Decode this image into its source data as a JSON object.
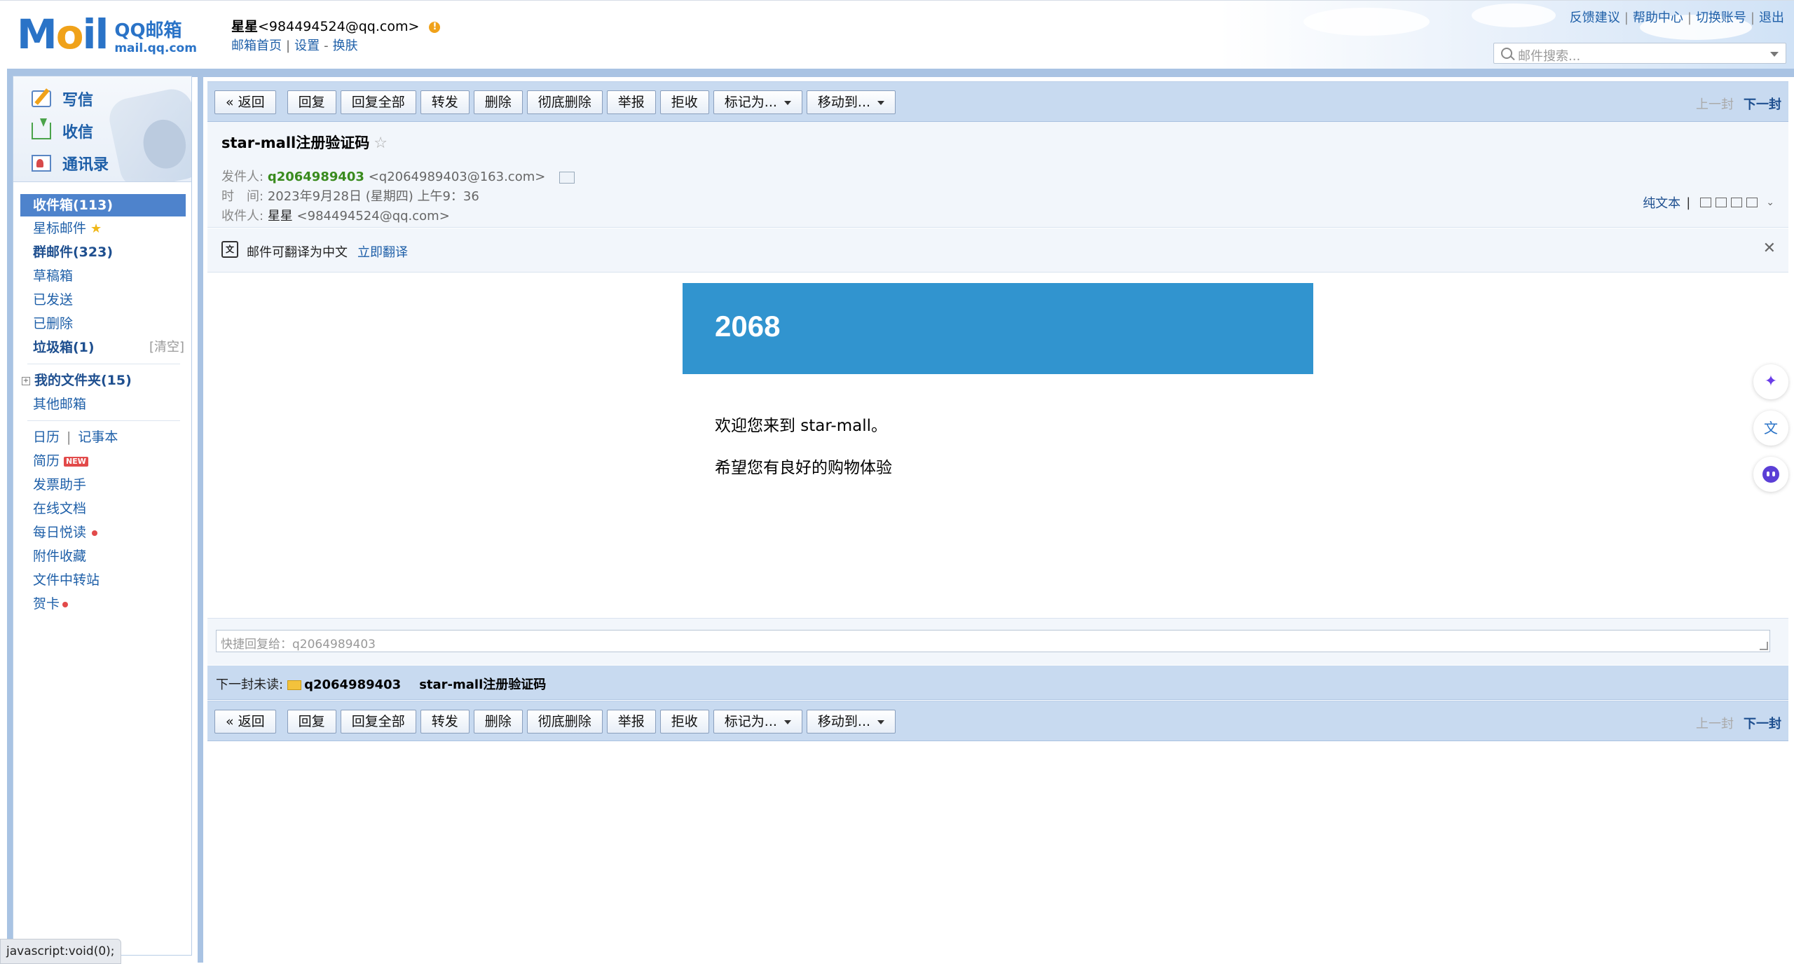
{
  "header": {
    "user_name": "星星",
    "user_email": "<984494524@qq.com>",
    "home_link": "邮箱首页",
    "settings_link": "设置",
    "skin_link": "换肤",
    "dash": "-",
    "logo_mail": "MAIL",
    "logo_qq": "QQ邮箱",
    "logo_domain": "mail.qq.com",
    "top_links": [
      "反馈建议",
      "帮助中心",
      "切换账号",
      "退出"
    ],
    "search_placeholder": "邮件搜索..."
  },
  "sidebar": {
    "quick": [
      "写信",
      "收信",
      "通讯录"
    ],
    "folders": {
      "inbox": "收件箱(113)",
      "starred": "星标邮件",
      "group": "群邮件(323)",
      "drafts": "草稿箱",
      "sent": "已发送",
      "deleted": "已删除",
      "spam": "垃圾箱(1)",
      "spam_clear": "[清空]",
      "my_folders": "我的文件夹(15)",
      "other": "其他邮箱"
    },
    "apps": {
      "calendar": "日历",
      "notes": "记事本",
      "resume": "简历",
      "resume_badge": "NEW",
      "invoice": "发票助手",
      "docs": "在线文档",
      "daily": "每日悦读",
      "attachments": "附件收藏",
      "transfer": "文件中转站",
      "cards": "贺卡"
    }
  },
  "toolbar": {
    "back": "« 返回",
    "reply": "回复",
    "reply_all": "回复全部",
    "forward": "转发",
    "delete": "删除",
    "delete_perm": "彻底删除",
    "report": "举报",
    "reject": "拒收",
    "mark_as": "标记为...",
    "move_to": "移动到...",
    "prev": "上一封",
    "next": "下一封"
  },
  "mail": {
    "subject": "star-mall注册验证码",
    "from_label": "发件人:",
    "from_name": "q2064989403",
    "from_addr": "<q2064989403@163.com>",
    "time_label": "时　间:",
    "time_value": "2023年9月28日 (星期四) 上午9：36",
    "to_label": "收件人:",
    "to_name": "星星",
    "to_addr": "<984494524@qq.com>",
    "plain_text": "纯文本",
    "translate_text": "邮件可翻译为中文",
    "translate_link": "立即翻译",
    "code": "2068",
    "line1": "欢迎您来到 star-mall。",
    "line2": "希望您有良好的购物体验"
  },
  "reply": {
    "placeholder": "快捷回复给：q2064989403"
  },
  "next_unread": {
    "label": "下一封未读:",
    "sender": "q2064989403",
    "subject": "star-mall注册验证码"
  },
  "status_bar": "javascript:void(0);",
  "colors": {
    "accent": "#2a73c7",
    "banner": "#3194cf",
    "toolbar": "#c8daf0",
    "active_folder": "#4e83cc"
  }
}
